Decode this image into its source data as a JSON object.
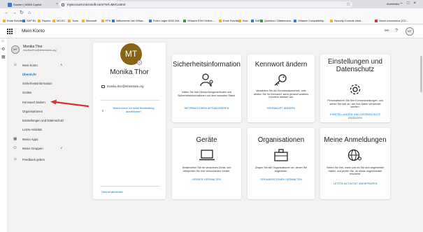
{
  "browser": {
    "tabs": [
      {
        "label": "Suchen | M365 Copilot",
        "active": false
      },
      {
        "label": "My Account",
        "active": true
      }
    ],
    "new_tab": "+",
    "url": "myaccount.microsoft.com/?ref=MeControl",
    "account_label": "Anmelden",
    "bookmarks": [
      "Erste Schritte",
      "SAP B1",
      "Psycho",
      "NO-EC",
      "Tools",
      "Microsoft",
      "FFH",
      "Willkommen bei VMwa...",
      "Polen Lager 6000 Zeil...",
      "VMware ESXi Online-...",
      "Erste Schritte",
      "Kido",
      "SAP",
      "Questico / Gästemana...",
      "VMware Compatibility...",
      "Security Console Infrai...",
      "Novel coronavirus (CO..."
    ]
  },
  "header": {
    "app_title": "Mein Konto",
    "user_initials": "MT"
  },
  "sidebar": {
    "user_name": "Monika Thor",
    "user_email": "monika.thor@lebenstein.org",
    "section_label": "Mein Konto",
    "items": [
      "Übersicht",
      "Sicherheitsinformation",
      "Geräte",
      "Kennwort ändern",
      "Organisationen",
      "Einstellungen und Datenschutz",
      "Letzte Aktivität"
    ],
    "my_apps": "Meine Apps",
    "my_groups": "Meine Gruppen",
    "feedback": "Feedback geben"
  },
  "profile": {
    "initials": "MT",
    "name": "Monika Thor",
    "email": "monika.thor@lebenstein.org",
    "why_text": "Warum kann ich keine Bearbeitung durchführen?",
    "change_link": "Überall abmelden"
  },
  "tiles": {
    "security": {
      "title": "Sicherheitsinformation",
      "desc": "Halten Sie Ihre Überprüfungsmethoden und Sicherheitsinformationen auf dem neuesten Stand.",
      "link": "INFORMATIONEN AKTUALISIEREN"
    },
    "password": {
      "title": "Kennwort ändern",
      "desc": "Verstärken Sie die Kennwortsicherheit, oder ändern Sie Ihr Kennwort, wenn jemand anderes Kenntnis darüber hat.",
      "link": "KENNWORT ÄNDERN"
    },
    "privacy": {
      "title": "Einstellungen und Datenschutz",
      "desc": "Personalisieren Sie Ihre Kontoeinstellungen, und sehen Sie sich an, wie Ihre Daten verwendet werden.",
      "link": "EINSTELLUNGEN UND DATENSCHUTZ ANZEIGEN"
    },
    "devices": {
      "title": "Geräte",
      "desc": "Deaktivieren Sie ein verlorenes Gerät, und überprüfen Sie Ihre verbundenen Geräte.",
      "link": "GERÄTE VERWALTEN"
    },
    "orgs": {
      "title": "Organisationen",
      "desc": "Zeigen Sie alle Organisationen an, denen Sie angehören.",
      "link": "ORGANISATIONEN VERWALTEN"
    },
    "signins": {
      "title": "Meine Anmeldungen",
      "desc": "Sehen Sie hier, wann und wo Sie sich angemeldet haben, und prüfen Sie, ob etwas ungewöhnlich erscheint.",
      "link": "LETZTE AKTIVITÄT ÜBERPRÜFEN"
    }
  },
  "colors": {
    "accent": "#0078d4",
    "avatar_bg": "#8a6416",
    "arrow": "#d13438"
  }
}
